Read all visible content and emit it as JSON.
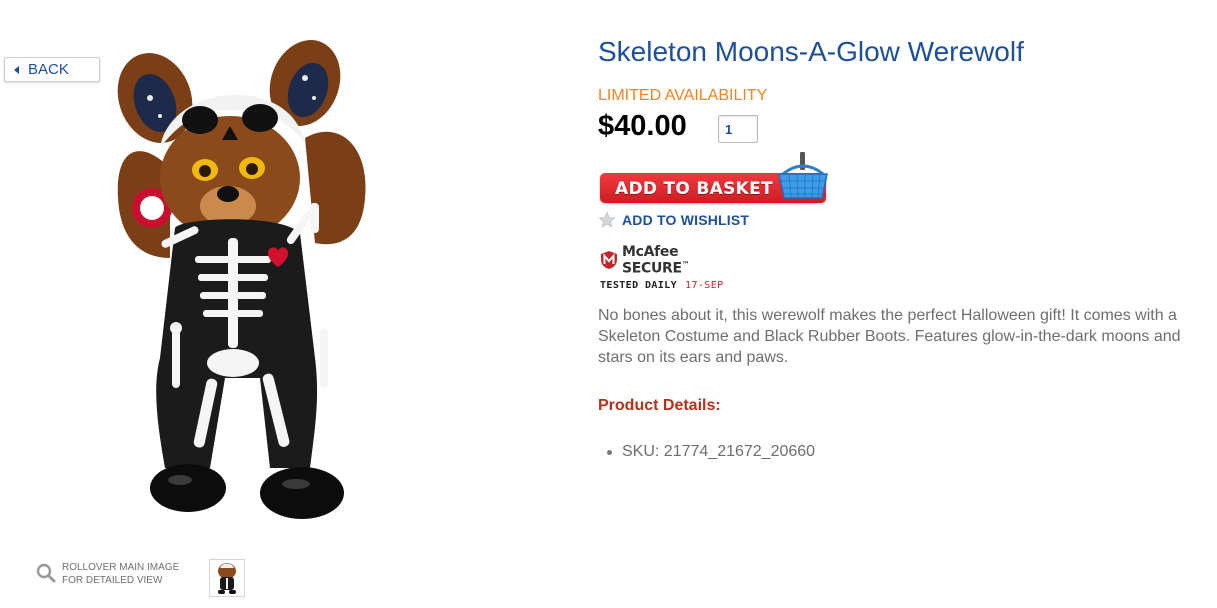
{
  "nav": {
    "back_label": "BACK"
  },
  "product": {
    "title": "Skeleton Moons-A-Glow Werewolf",
    "availability": "LIMITED AVAILABILITY",
    "price": "$40.00",
    "quantity": "1",
    "add_to_basket_label": "ADD TO BASKET",
    "add_to_wishlist_label": "ADD TO WISHLIST",
    "description": "No bones about it, this werewolf makes the perfect Halloween gift! It comes with a Skeleton Costume and Black Rubber Boots. Features glow-in-the-dark moons and stars on its ears and paws.",
    "details_heading": "Product Details:",
    "details": [
      {
        "label": "SKU:",
        "value": "21774_21672_20660"
      }
    ]
  },
  "security_badge": {
    "brand": "McAfee",
    "product": "SECURE",
    "tested_label": "TESTED DAILY",
    "date": "17-SEP"
  },
  "gallery": {
    "hint_line1": "ROLLOVER MAIN IMAGE",
    "hint_line2": "FOR DETAILED VIEW"
  },
  "colors": {
    "brand_blue": "#1d4f9c",
    "availability_orange": "#f58220",
    "basket_red": "#e0262d",
    "details_red": "#b1321b",
    "body_gray": "#6e6e6e"
  },
  "icons": [
    "back-arrow-icon",
    "basket-icon",
    "star-icon",
    "mcafee-shield-icon",
    "magnifier-icon"
  ]
}
